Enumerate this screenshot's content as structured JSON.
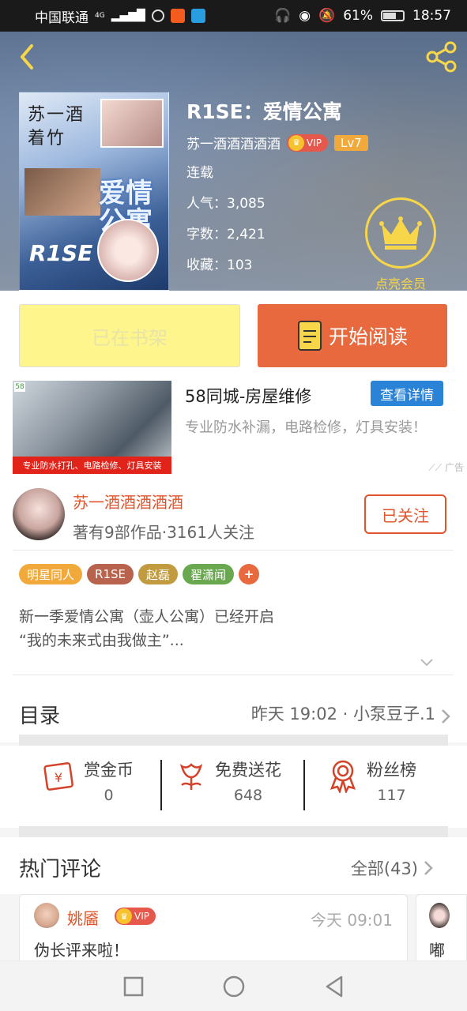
{
  "status_bar": {
    "carrier": "中国联通",
    "net": "4G",
    "battery": "61%",
    "time": "18:57"
  },
  "book": {
    "title": "R1SE：爱情公寓",
    "author": "苏一酒酒酒酒酒",
    "vip_label": "VIP",
    "level": "Lv7",
    "status": "连载",
    "popularity_label": "人气：",
    "popularity": "3,085",
    "word_label": "字数：",
    "words": "2,421",
    "fav_label": "收藏：",
    "favorites": "103",
    "member_label": "点亮会员",
    "cover_title": "苏一酒\n着竹",
    "cover_big": "爱情\n公寓",
    "cover_sig": "R1SE"
  },
  "actions": {
    "shelf_label": "已在书架",
    "read_label": "开始阅读"
  },
  "ad": {
    "title": "58同城-房屋维修",
    "button": "查看详情",
    "desc": "专业防水补漏，电路检修，灯具安装！",
    "image_caption": "专业防水打孔、电路检修、灯具安装",
    "logo": "58",
    "label": "广告"
  },
  "author": {
    "name": "苏一酒酒酒酒酒",
    "meta": "著有9部作品·3161人关注",
    "follow_label": "已关注",
    "tags": [
      {
        "label": "明星同人",
        "color": "#f2a93b"
      },
      {
        "label": "R1SE",
        "color": "#b7634e"
      },
      {
        "label": "赵磊",
        "color": "#c29a3f"
      },
      {
        "label": "翟潇闻",
        "color": "#6aa84f"
      },
      {
        "label": "+",
        "color": "#e9693e"
      }
    ],
    "intro_line1": "新一季爱情公寓（壶人公寓）已经开启",
    "intro_line2": "“我的未来式由我做主”..."
  },
  "toc": {
    "label": "目录",
    "latest": "昨天 19:02 · 小泵豆子.1"
  },
  "stats": [
    {
      "label": "赏金币",
      "value": "0",
      "icon": "reward-coin-icon"
    },
    {
      "label": "免费送花",
      "value": "648",
      "icon": "flower-icon"
    },
    {
      "label": "粉丝榜",
      "value": "117",
      "icon": "medal-icon"
    }
  ],
  "comments": {
    "label": "热门评论",
    "all": "全部(43)",
    "items": [
      {
        "user": "姚靥",
        "vip_label": "VIP",
        "time": "今天 09:01",
        "text": "伪长评来啦！"
      },
      {
        "text": "嘟"
      }
    ]
  },
  "colors": {
    "accent": "#e0552c",
    "read_button": "#e9693e",
    "shelf_button": "#fef58c",
    "ad_button": "#2a83d6",
    "member_gold": "#f7d64a"
  }
}
